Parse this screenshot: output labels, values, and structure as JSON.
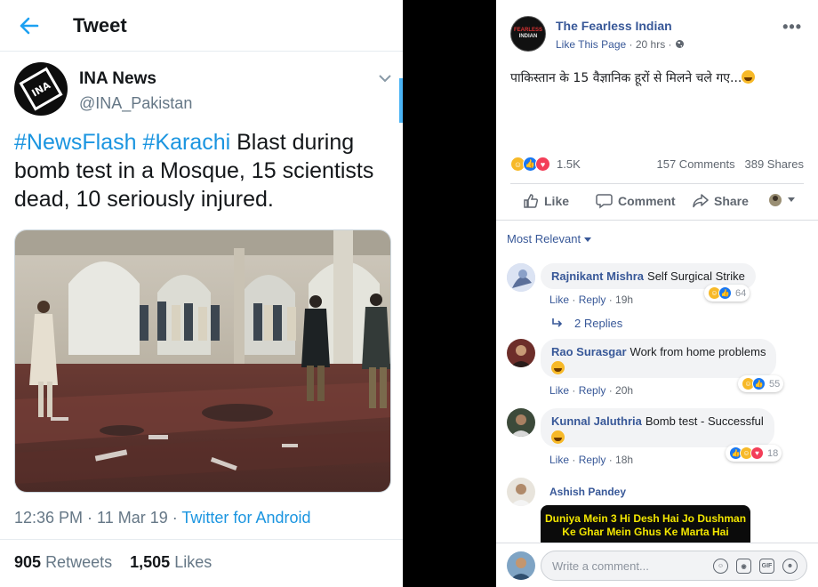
{
  "tweet": {
    "header_title": "Tweet",
    "name": "INA News",
    "handle": "@INA_Pakistan",
    "avatar_text": "INA",
    "hashtag1": "#NewsFlash",
    "hashtag2": "#Karachi",
    "body_text": " Blast during bomb test in a Mosque, 15 scientists dead, 10 seriously injured.",
    "time": "12:36 PM · 11 Mar 19 · ",
    "source": "Twitter for Android",
    "retweets_count": "905",
    "retweets_label": "Retweets",
    "likes_count": "1,505",
    "likes_label": "Likes"
  },
  "facebook": {
    "page_name": "The Fearless Indian",
    "avatar_line1": "FEARLESS",
    "avatar_line2": "INDIAN",
    "like_page": "Like This Page",
    "time": "· 20 hrs ·",
    "more": "•••",
    "post_text": "पाकिस्तान के 15 वैज्ञानिक हूरों से मिलने चले गए...",
    "reactions_count": "1.5K",
    "comments_count": "157 Comments",
    "shares_count": "389 Shares",
    "actions": {
      "like": "Like",
      "comment": "Comment",
      "share": "Share"
    },
    "sort_label": "Most Relevant",
    "comments": [
      {
        "author": "Rajnikant Mishra",
        "text": "Self Surgical Strike",
        "like": "Like",
        "reply": "Reply",
        "time": "19h",
        "react_count": "64"
      },
      {
        "author": "Rao Surasgar",
        "text": "Work from home problems",
        "like": "Like",
        "reply": "Reply",
        "time": "20h",
        "react_count": "55"
      },
      {
        "author": "Kunnal Jaluthria",
        "text": "Bomb test - Successful",
        "like": "Like",
        "reply": "Reply",
        "time": "18h",
        "react_count": "18"
      },
      {
        "author": "Ashish Pandey"
      }
    ],
    "replies_label": "2 Replies",
    "meme_line1": "Duniya Mein 3 Hi Desh Hai Jo Dushman",
    "meme_line2": "Ke Ghar Mein Ghus Ke Marta Hai",
    "write_placeholder": "Write a comment...",
    "gif_label": "GIF"
  }
}
